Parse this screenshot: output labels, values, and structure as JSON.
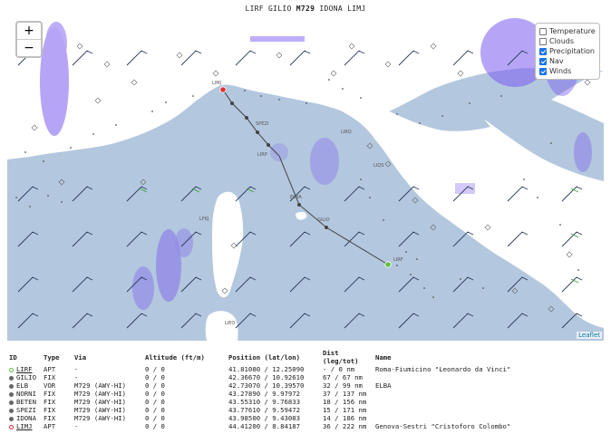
{
  "route_title": {
    "from": "LIRF",
    "p1": "GILIO",
    "airway": "M729",
    "p2": "IDONA",
    "to": "LIMJ"
  },
  "zoom": {
    "plus": "+",
    "minus": "−"
  },
  "layers": [
    {
      "label": "Temperature",
      "checked": false
    },
    {
      "label": "Clouds",
      "checked": false
    },
    {
      "label": "Precipitation",
      "checked": true
    },
    {
      "label": "Nav",
      "checked": true
    },
    {
      "label": "Winds",
      "checked": true
    }
  ],
  "attribution": "Leaflet",
  "map_labels": [
    "LIMJ",
    "SPEZI",
    "ELBA",
    "GILIO",
    "LIRF",
    "LIRQ",
    "LFKJ",
    "LIRP",
    "LIEO",
    "LIQS"
  ],
  "table": {
    "headers": {
      "id": "ID",
      "type": "Type",
      "via": "Via",
      "altitude": "Altitude (ft/m)",
      "position": "Position (lat/lon)",
      "dist": "Dist (leg/tot)",
      "name": "Name"
    },
    "rows": [
      {
        "id": "LIRF",
        "type": "APT",
        "via": "-",
        "altitude": "0 / 0",
        "position": "41.81080 / 12.25090",
        "dist": "- / 0 nm",
        "name": "Roma-Fiumicino \"Leonardo da Vinci\"",
        "marker": "start"
      },
      {
        "id": "GILIO",
        "type": "FIX",
        "via": "-",
        "altitude": "0 / 0",
        "position": "42.36670 / 10.92610",
        "dist": "67 / 67 nm",
        "name": "",
        "marker": "fix"
      },
      {
        "id": "ELB",
        "type": "VOR",
        "via": "M729 (AWY-HI)",
        "altitude": "0 / 0",
        "position": "42.73070 / 10.39570",
        "dist": "32 / 99 nm",
        "name": "ELBA",
        "marker": "fix"
      },
      {
        "id": "NORNI",
        "type": "FIX",
        "via": "M729 (AWY-HI)",
        "altitude": "0 / 0",
        "position": "43.27890 / 9.97972",
        "dist": "37 / 137 nm",
        "name": "",
        "marker": "fix"
      },
      {
        "id": "BETEN",
        "type": "FIX",
        "via": "M729 (AWY-HI)",
        "altitude": "0 / 0",
        "position": "43.55310 / 9.76833",
        "dist": "18 / 156 nm",
        "name": "",
        "marker": "fix"
      },
      {
        "id": "SPEZI",
        "type": "FIX",
        "via": "M729 (AWY-HI)",
        "altitude": "0 / 0",
        "position": "43.77610 / 9.59472",
        "dist": "15 / 171 nm",
        "name": "",
        "marker": "fix"
      },
      {
        "id": "IDONA",
        "type": "FIX",
        "via": "M729 (AWY-HI)",
        "altitude": "0 / 0",
        "position": "43.98500 / 9.43083",
        "dist": "14 / 186 nm",
        "name": "",
        "marker": "fix"
      },
      {
        "id": "LIMJ",
        "type": "APT",
        "via": "-",
        "altitude": "0 / 0",
        "position": "44.41200 / 8.84187",
        "dist": "36 / 222 nm",
        "name": "Genova-Sestri \"Cristoforo Colombo\"",
        "marker": "end"
      }
    ]
  },
  "colors": {
    "sea": "#b3c7de",
    "land": "#ffffff",
    "precip": "#7b5cf0",
    "start_marker": "#5bc236",
    "end_marker": "#e03030",
    "route": "#444444"
  }
}
